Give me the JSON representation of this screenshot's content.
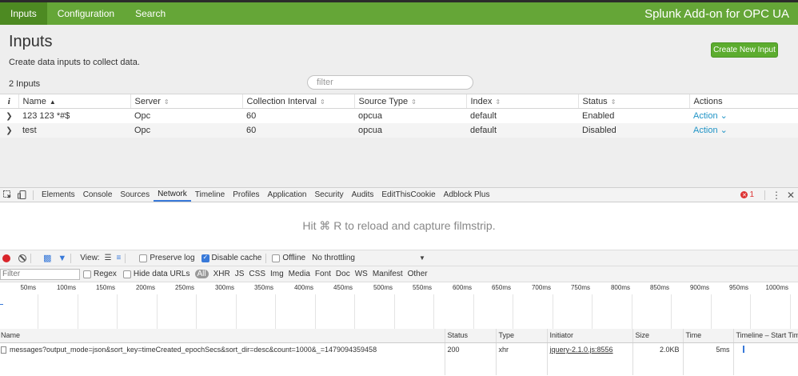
{
  "app": {
    "nav": [
      "Inputs",
      "Configuration",
      "Search"
    ],
    "title": "Splunk Add-on for OPC UA"
  },
  "page": {
    "title": "Inputs",
    "description": "Create data inputs to collect data.",
    "create_button": "Create New Input",
    "count": "2 Inputs",
    "filter_placeholder": "filter"
  },
  "inputs_table": {
    "info_col": "i",
    "columns": [
      "Name",
      "Server",
      "Collection Interval",
      "Source Type",
      "Index",
      "Status",
      "Actions"
    ],
    "rows": [
      {
        "name": "123 123 *#$",
        "server": "Opc",
        "interval": "60",
        "sourcetype": "opcua",
        "index": "default",
        "status": "Enabled",
        "action": "Action"
      },
      {
        "name": "test",
        "server": "Opc",
        "interval": "60",
        "sourcetype": "opcua",
        "index": "default",
        "status": "Disabled",
        "action": "Action"
      }
    ]
  },
  "devtools": {
    "tabs": [
      "Elements",
      "Console",
      "Sources",
      "Network",
      "Timeline",
      "Profiles",
      "Application",
      "Security",
      "Audits",
      "EditThisCookie",
      "Adblock Plus"
    ],
    "active_tab": "Network",
    "error_count": "1",
    "filmstrip_hint": "Hit ⌘ R to reload and capture filmstrip.",
    "toolbar": {
      "view_label": "View:",
      "preserve_log": "Preserve log",
      "disable_cache": "Disable cache",
      "offline": "Offline",
      "throttling": "No throttling"
    },
    "filter": {
      "placeholder": "Filter",
      "regex": "Regex",
      "hide_data_urls": "Hide data URLs",
      "types": [
        "All",
        "XHR",
        "JS",
        "CSS",
        "Img",
        "Media",
        "Font",
        "Doc",
        "WS",
        "Manifest",
        "Other"
      ]
    },
    "timeline_ticks": [
      "50ms",
      "100ms",
      "150ms",
      "200ms",
      "250ms",
      "300ms",
      "350ms",
      "400ms",
      "450ms",
      "500ms",
      "550ms",
      "600ms",
      "650ms",
      "700ms",
      "750ms",
      "800ms",
      "850ms",
      "900ms",
      "950ms",
      "1000ms"
    ],
    "net_table": {
      "columns": [
        "Name",
        "Status",
        "Type",
        "Initiator",
        "Size",
        "Time",
        "Timeline – Start Time"
      ],
      "rows": [
        {
          "name": "messages?output_mode=json&sort_key=timeCreated_epochSecs&sort_dir=desc&count=1000&_=1479094359458",
          "status": "200",
          "type": "xhr",
          "initiator": "jquery-2.1.0.js:8556",
          "size": "2.0KB",
          "time": "5ms"
        }
      ]
    }
  }
}
